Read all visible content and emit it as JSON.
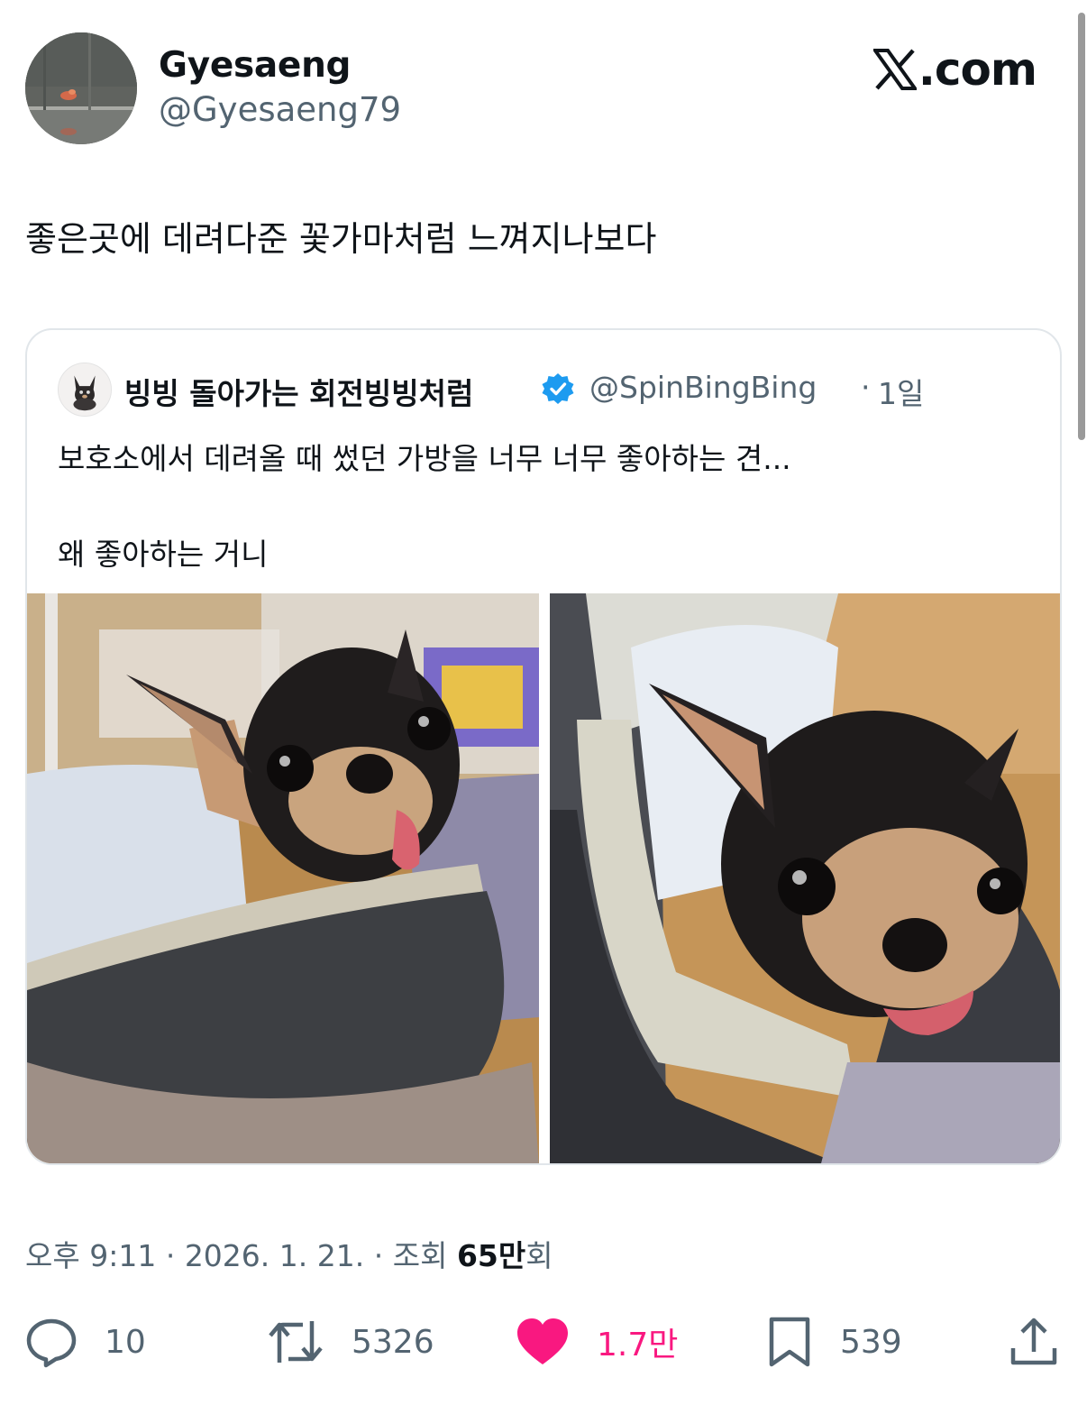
{
  "author": {
    "display_name": "Gyesaeng",
    "handle": "@Gyesaeng79"
  },
  "brand": {
    "label": ".com"
  },
  "tweet": {
    "text": "좋은곳에 데려다준 꽃가마처럼 느껴지나보다"
  },
  "quoted": {
    "display_name": "빙빙 돌아가는 회전빙빙처럼",
    "handle": "@SpinBingBing",
    "separator": "·",
    "time": "1일",
    "line1": "보호소에서 데려올 때 썼던 가방을 너무 너무 좋아하는 견...",
    "line2": "왜 좋아하는 거니"
  },
  "meta": {
    "time": "오후 9:11",
    "sep1": " · ",
    "date": "2026. 1. 21.",
    "sep2": " · ",
    "views_label": "조회 ",
    "views_value": "65만",
    "views_suffix": "회"
  },
  "actions": {
    "replies": "10",
    "retweets": "5326",
    "likes": "1.7만",
    "bookmarks": "539"
  },
  "colors": {
    "like": "#f91880",
    "muted": "#536471",
    "verified": "#1d9bf0",
    "text": "#0f1419"
  },
  "icons": {
    "reply": "speech-bubble-icon",
    "retweet": "retweet-arrows-icon",
    "like": "heart-filled-icon",
    "bookmark": "bookmark-icon",
    "share": "share-upload-icon",
    "verified": "verified-badge-icon",
    "brand": "x-logo-icon"
  }
}
